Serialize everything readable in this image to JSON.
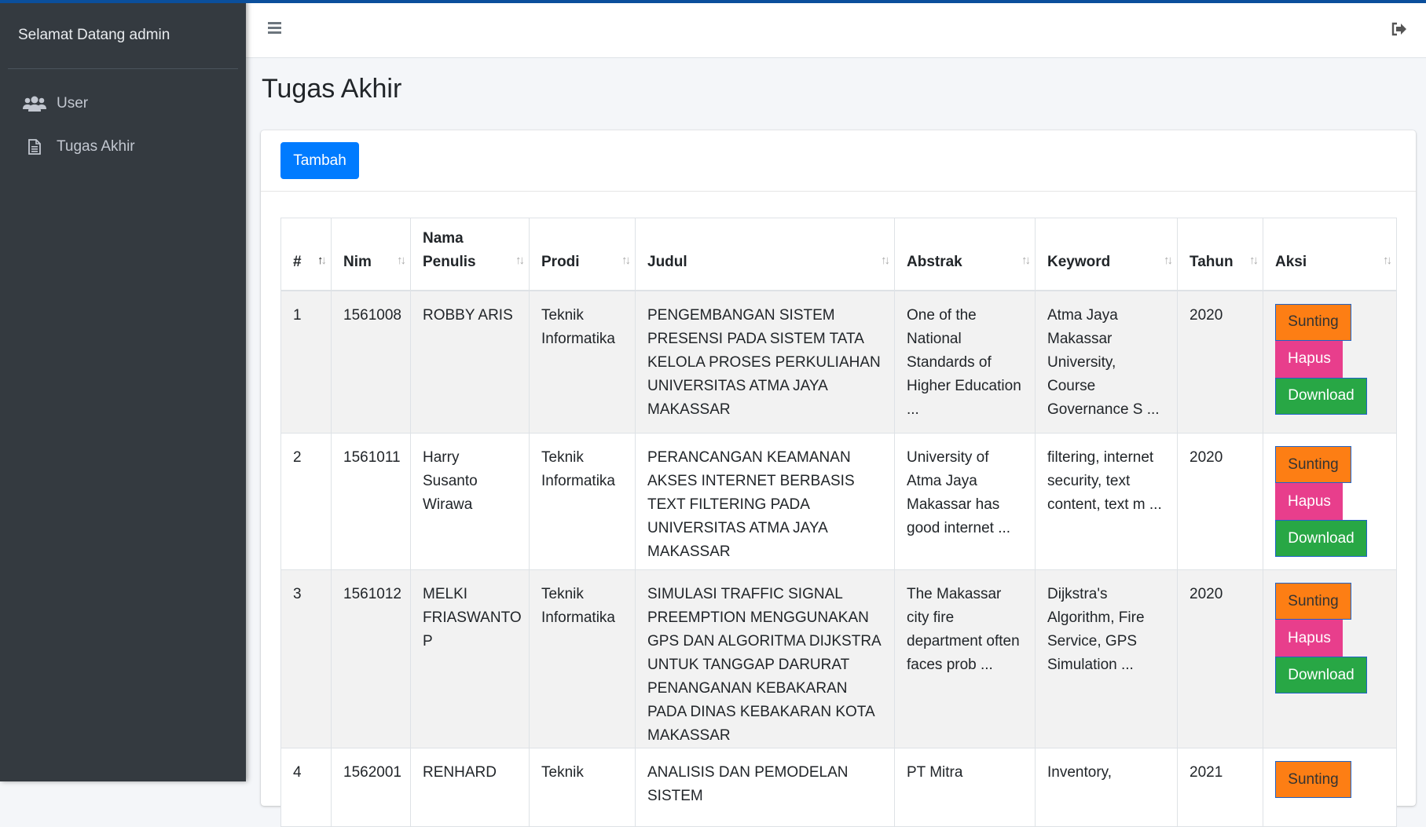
{
  "sidebar": {
    "welcome": "Selamat Datang admin",
    "items": [
      {
        "label": "User",
        "icon": "users-icon"
      },
      {
        "label": "Tugas Akhir",
        "icon": "file-icon"
      }
    ]
  },
  "header": {
    "menu_icon": "hamburger-icon",
    "logout_icon": "logout-icon"
  },
  "page": {
    "title": "Tugas Akhir",
    "add_label": "Tambah"
  },
  "table": {
    "columns": [
      "#",
      "Nim",
      "Nama Penulis",
      "Prodi",
      "Judul",
      "Abstrak",
      "Keyword",
      "Tahun",
      "Aksi"
    ],
    "action_labels": {
      "edit": "Sunting",
      "delete": "Hapus",
      "download": "Download"
    },
    "rows": [
      {
        "no": "1",
        "nim": "1561008",
        "nama": "ROBBY ARIS",
        "prodi": "Teknik Informatika",
        "judul": "PENGEMBANGAN SISTEM PRESENSI PADA SISTEM TATA KELOLA PROSES PERKULIAHAN UNIVERSITAS ATMA JAYA MAKASSAR",
        "abstrak": "One of the National Standards of Higher Education ...",
        "keyword": "Atma Jaya Makassar University, Course Governance S ...",
        "tahun": "2020"
      },
      {
        "no": "2",
        "nim": "1561011",
        "nama": "Harry Susanto Wirawa",
        "prodi": "Teknik Informatika",
        "judul": "PERANCANGAN KEAMANAN AKSES INTERNET BERBASIS TEXT FILTERING PADA UNIVERSITAS ATMA JAYA MAKASSAR",
        "abstrak": "University of Atma Jaya Makassar has good internet ...",
        "keyword": "filtering, internet security, text content, text m ...",
        "tahun": "2020"
      },
      {
        "no": "3",
        "nim": "1561012",
        "nama": "MELKI FRIASWANTO P",
        "prodi": "Teknik Informatika",
        "judul": "SIMULASI TRAFFIC SIGNAL PREEMPTION MENGGUNAKAN GPS DAN ALGORITMA DIJKSTRA UNTUK TANGGAP DARURAT PENANGANAN KEBAKARAN PADA DINAS KEBAKARAN KOTA MAKASSAR",
        "abstrak": "The Makassar city fire department often faces prob ...",
        "keyword": "Dijkstra's Algorithm, Fire Service, GPS Simulation ...",
        "tahun": "2020"
      },
      {
        "no": "4",
        "nim": "1562001",
        "nama": "RENHARD",
        "prodi": "Teknik",
        "judul": "ANALISIS DAN PEMODELAN SISTEM",
        "abstrak": "PT Mitra",
        "keyword": "Inventory,",
        "tahun": "2021"
      }
    ]
  }
}
